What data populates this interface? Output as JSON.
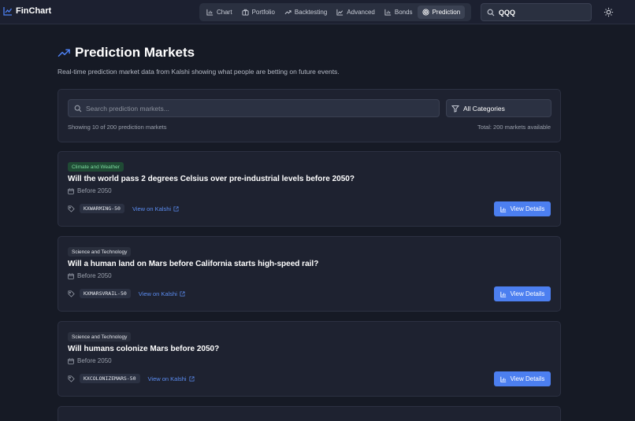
{
  "brand": {
    "name": "FinChart"
  },
  "nav": {
    "items": [
      {
        "label": "Chart",
        "icon": "bar-chart-icon"
      },
      {
        "label": "Portfolio",
        "icon": "briefcase-icon"
      },
      {
        "label": "Backtesting",
        "icon": "trend-icon"
      },
      {
        "label": "Advanced",
        "icon": "line-chart-icon"
      },
      {
        "label": "Bonds",
        "icon": "bar-chart-icon"
      },
      {
        "label": "Prediction",
        "icon": "target-icon",
        "active": true
      }
    ]
  },
  "search": {
    "value": "QQQ"
  },
  "page": {
    "title": "Prediction Markets",
    "subtitle": "Real-time prediction market data from Kalshi showing what people are betting on future events."
  },
  "filters": {
    "search_placeholder": "Search prediction markets...",
    "category": "All Categories",
    "showing": "Showing 10 of 200 prediction markets",
    "total": "Total: 200 markets available"
  },
  "markets": [
    {
      "category": "Climate and Weather",
      "title": "Will the world pass 2 degrees Celsius over pre-industrial levels before 2050?",
      "date": "Before 2050",
      "ticker": "KXWARMING-50",
      "link_label": "View on Kalshi",
      "button_label": "View Details"
    },
    {
      "category": "Science and Technology",
      "title": "Will a human land on Mars before California starts high-speed rail?",
      "date": "Before 2050",
      "ticker": "KXMARSVRAIL-50",
      "link_label": "View on Kalshi",
      "button_label": "View Details"
    },
    {
      "category": "Science and Technology",
      "title": "Will humans colonize Mars before 2050?",
      "date": "Before 2050",
      "ticker": "KXCOLONIZEMARS-50",
      "link_label": "View on Kalshi",
      "button_label": "View Details"
    }
  ],
  "colors": {
    "background": "#161a25",
    "accent": "#4c7ff0",
    "link": "#5b8cf0",
    "climate_badge": "#1f4a34"
  }
}
